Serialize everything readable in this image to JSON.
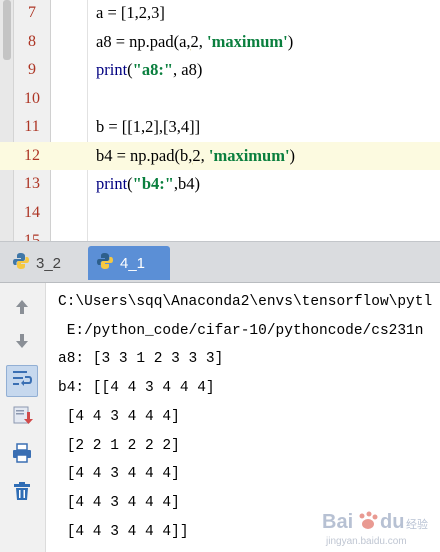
{
  "editor": {
    "lines": [
      {
        "num": "7",
        "code": [
          {
            "t": "a = [1,2,3]"
          }
        ]
      },
      {
        "num": "8",
        "code": [
          {
            "t": "a8 = np.pad(a"
          },
          {
            "t": ",",
            "cls": "wavy"
          },
          {
            "t": "2, "
          },
          {
            "t": "'maximum'",
            "cls": "c-str"
          },
          {
            "t": ")"
          }
        ]
      },
      {
        "num": "9",
        "code": [
          {
            "t": "print",
            "cls": "c-kw"
          },
          {
            "t": "("
          },
          {
            "t": "\"a8:\"",
            "cls": "c-str"
          },
          {
            "t": ", a8)"
          }
        ]
      },
      {
        "num": "10",
        "code": []
      },
      {
        "num": "11",
        "code": [
          {
            "t": "b = [[1,2],[3,4]]"
          }
        ]
      },
      {
        "num": "12",
        "code": [
          {
            "t": "b4 = np.pad(b"
          },
          {
            "t": ",",
            "cls": "wavy"
          },
          {
            "t": "2, "
          },
          {
            "t": "'maximum'",
            "cls": "c-str"
          },
          {
            "t": ")"
          }
        ]
      },
      {
        "num": "13",
        "code": [
          {
            "t": "print",
            "cls": "c-kw"
          },
          {
            "t": "("
          },
          {
            "t": "\"b4:\"",
            "cls": "c-str"
          },
          {
            "t": ",b4)"
          }
        ]
      },
      {
        "num": "14",
        "code": []
      },
      {
        "num": "15",
        "code": []
      }
    ],
    "current_line": "12"
  },
  "tabs": [
    {
      "label": "3_2",
      "active": false
    },
    {
      "label": "4_1",
      "active": true
    }
  ],
  "toolbar": {
    "icons": [
      "arrow-up-icon",
      "arrow-down-icon",
      "soft-wrap-icon",
      "scroll-to-end-icon",
      "print-icon",
      "trash-icon"
    ]
  },
  "console": {
    "lines": [
      "C:\\Users\\sqq\\Anaconda2\\envs\\tensorflow\\pytl",
      " E:/python_code/cifar-10/pythoncode/cs231n",
      "a8: [3 3 1 2 3 3 3]",
      "b4: [[4 4 3 4 4 4]",
      " [4 4 3 4 4 4]",
      " [2 2 1 2 2 2]",
      " [4 4 3 4 4 4]",
      " [4 4 3 4 4 4]",
      " [4 4 3 4 4 4]]"
    ]
  },
  "watermark": {
    "text": "Bai du 经验",
    "sub": "jingyan.baidu.com"
  },
  "colors": {
    "line_number": "#ad3524",
    "string": "#0a7f3e",
    "keyword": "#000080",
    "current_line_bg": "#fcfae0",
    "active_tab": "#5b8fd6"
  }
}
